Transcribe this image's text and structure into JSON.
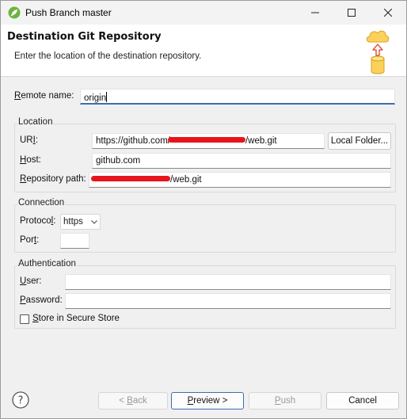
{
  "window": {
    "title": "Push Branch master",
    "icon": "spring-leaf-icon"
  },
  "header": {
    "title": "Destination Git Repository",
    "description": "Enter the location of the destination repository.",
    "icon": "cloud-database-upload-icon"
  },
  "remote": {
    "label_prefix": "R",
    "label_rest": "emote name:",
    "value": "origin"
  },
  "location": {
    "group_title": "Location",
    "uri_label_prefix": "UR",
    "uri_label_accel": "I",
    "uri_label_suffix": ":",
    "uri_value_start": "https://github.com/",
    "uri_value_end": "/web.git",
    "local_folder_button": "Local Folder...",
    "host_label_accel": "H",
    "host_label_rest": "ost:",
    "host_value": "github.com",
    "repo_label_accel": "R",
    "repo_label_rest": "epository path:",
    "repo_value_end": "/web.git"
  },
  "connection": {
    "group_title": "Connection",
    "protocol_label_prefix": "Protoco",
    "protocol_label_accel": "l",
    "protocol_label_suffix": ":",
    "protocol_value": "https",
    "port_label_prefix": "Por",
    "port_label_accel": "t",
    "port_label_suffix": ":",
    "port_value": ""
  },
  "authentication": {
    "group_title": "Authentication",
    "user_label_accel": "U",
    "user_label_rest": "ser:",
    "user_value": "",
    "password_label_accel": "P",
    "password_label_rest": "assword:",
    "password_value": "",
    "secure_store_accel": "S",
    "secure_store_rest": "tore in Secure Store",
    "secure_store_checked": false
  },
  "footer": {
    "back_prefix": "< ",
    "back_accel": "B",
    "back_rest": "ack",
    "preview_accel": "P",
    "preview_rest": "review >",
    "push_accel": "P",
    "push_rest": "ush",
    "cancel": "Cancel"
  },
  "colors": {
    "focus_accent": "#3a6fb0",
    "redaction": "#e8141d",
    "app_icon": "#6db33f"
  }
}
